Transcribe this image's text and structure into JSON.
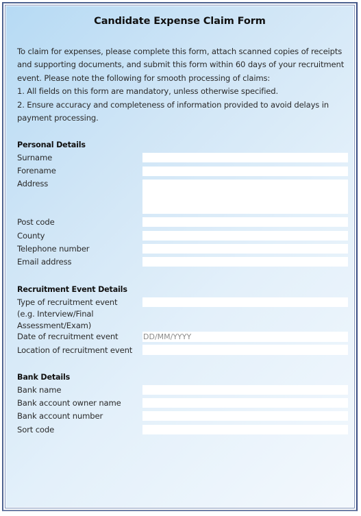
{
  "form": {
    "title": "Candidate Expense Claim Form",
    "intro": [
      "To claim for expenses, please complete this form, attach scanned copies of receipts and supporting documents, and submit this form within 60 days of your recruitment event. Please note the following for smooth processing of claims:",
      "1.  All fields on this form are mandatory, unless otherwise specified.",
      "2.  Ensure accuracy and completeness of information provided to avoid delays in payment processing."
    ]
  },
  "sections": {
    "personal": {
      "title": "Personal Details",
      "fields": {
        "surname": {
          "label": "Surname",
          "value": "",
          "placeholder": ""
        },
        "forename": {
          "label": "Forename",
          "value": "",
          "placeholder": ""
        },
        "address": {
          "label": "Address",
          "value": "",
          "placeholder": ""
        },
        "postcode": {
          "label": "Post code",
          "value": "",
          "placeholder": ""
        },
        "county": {
          "label": "County",
          "value": "",
          "placeholder": ""
        },
        "telephone": {
          "label": "Telephone number",
          "value": "",
          "placeholder": ""
        },
        "email": {
          "label": "Email address",
          "value": "",
          "placeholder": ""
        }
      }
    },
    "recruitment": {
      "title": "Recruitment Event Details",
      "fields": {
        "event_type": {
          "label": "Type of recruitment event (e.g. Interview/Final Assessment/Exam)",
          "value": "",
          "placeholder": ""
        },
        "event_date": {
          "label": "Date of recruitment event",
          "value": "",
          "placeholder": "DD/MM/YYYY"
        },
        "event_location": {
          "label": "Location of recruitment event",
          "value": "",
          "placeholder": ""
        }
      }
    },
    "bank": {
      "title": "Bank Details",
      "fields": {
        "bank_name": {
          "label": "Bank name",
          "value": "",
          "placeholder": ""
        },
        "owner_name": {
          "label": "Bank account owner name",
          "value": "",
          "placeholder": ""
        },
        "account_number": {
          "label": "Bank account number",
          "value": "",
          "placeholder": ""
        },
        "sort_code": {
          "label": "Sort code",
          "value": "",
          "placeholder": ""
        }
      }
    }
  },
  "colors": {
    "frame": "#4d6290",
    "panel_start": "#b6daf4",
    "panel_end": "#f3f8fd",
    "field_bg": "#ffffff",
    "placeholder": "#8a8a8a"
  }
}
